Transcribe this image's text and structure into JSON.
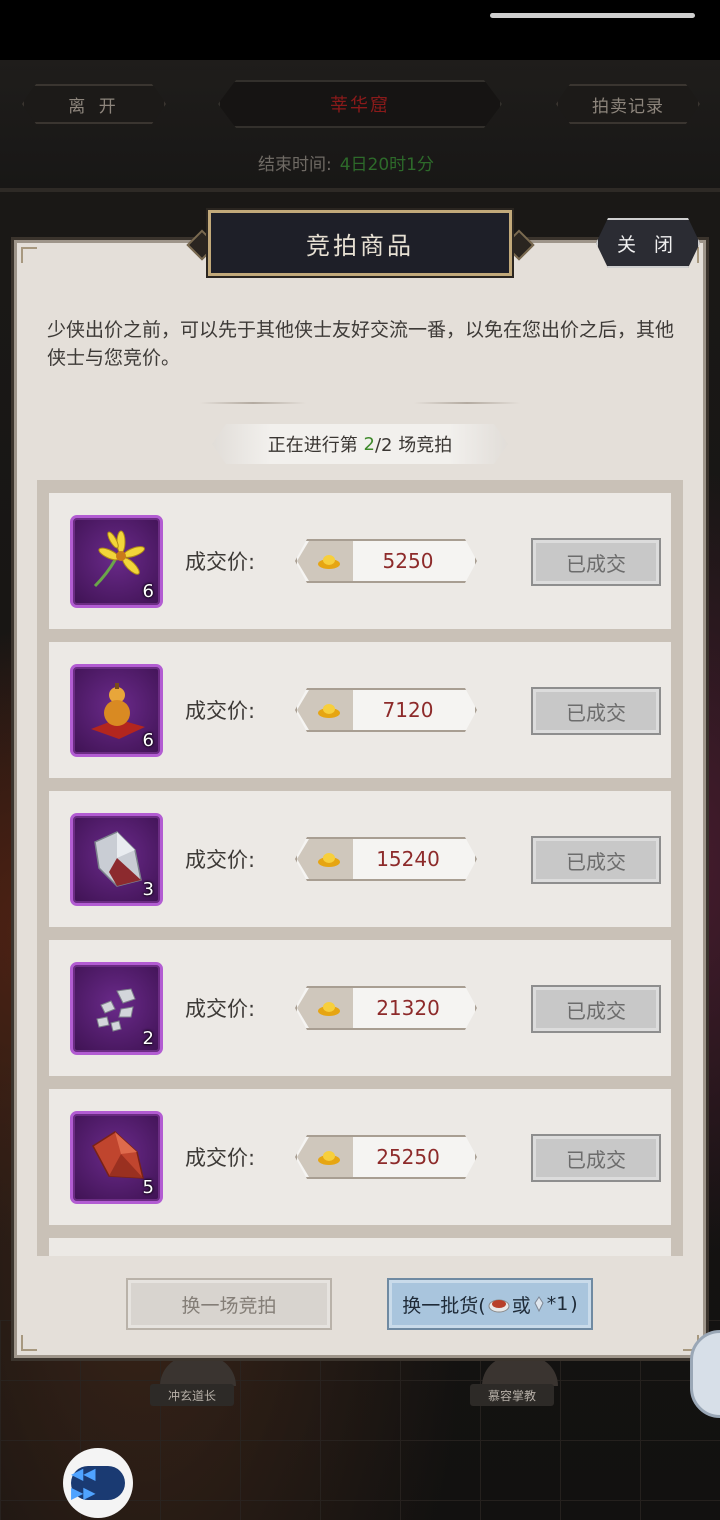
{
  "header": {
    "leave_label": "离 开",
    "title": "莘华窟",
    "record_label": "拍卖记录",
    "end_time_label": "结束时间:",
    "end_time_value": "4日20时1分"
  },
  "panel": {
    "title": "竞拍商品",
    "close_label": "关 闭",
    "tip": "少侠出价之前，可以先于其他侠士友好交流一番，以免在您出价之后，其他侠士与您竞价。",
    "round_prefix": "正在进行第 ",
    "round_current": "2",
    "round_suffix": "/2 场竞拍",
    "price_label": "成交价:",
    "sold_label": "已成交",
    "items": [
      {
        "icon": "flower-icon",
        "qty": "6",
        "price": "5250"
      },
      {
        "icon": "gourd-icon",
        "qty": "6",
        "price": "7120"
      },
      {
        "icon": "crystal-ore-icon",
        "qty": "3",
        "price": "15240"
      },
      {
        "icon": "iron-fragments-icon",
        "qty": "2",
        "price": "21320"
      },
      {
        "icon": "red-ore-icon",
        "qty": "5",
        "price": "25250"
      }
    ],
    "switch_round_label": "换一场竞拍",
    "refresh_goods_prefix": "换一批货(",
    "refresh_goods_or": "或",
    "refresh_goods_count": "*1",
    "refresh_goods_suffix": ")"
  },
  "background": {
    "npc_left": "冲玄道长",
    "npc_right": "慕容掌教"
  },
  "colors": {
    "panel_bg": "#e4dfd9",
    "title_bg": "#1e1f28",
    "price_text": "#8d2a2a",
    "slot_border": "#b25cd2",
    "refresh_btn": "#a9c5dd"
  }
}
